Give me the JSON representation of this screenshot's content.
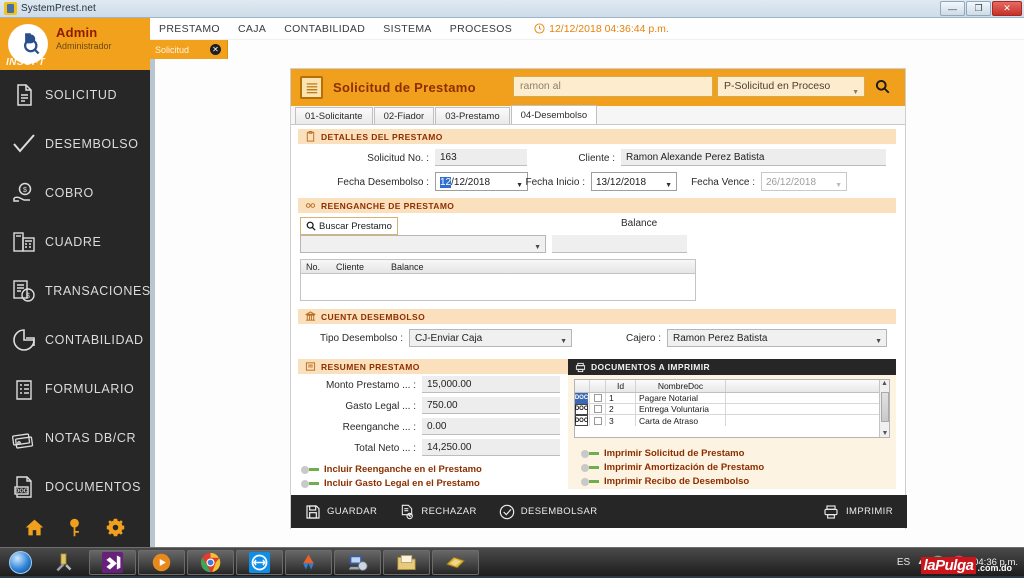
{
  "window": {
    "title": "SystemPrest.net",
    "controls": {
      "minimize": "—",
      "maximize": "❐",
      "close": "✕"
    }
  },
  "sidebar": {
    "user": {
      "name": "Admin",
      "role": "Administrador",
      "brand": "INSOFT"
    },
    "items": [
      {
        "label": "SOLICITUD",
        "icon": "document-icon"
      },
      {
        "label": "DESEMBOLSO",
        "icon": "checkmark-icon"
      },
      {
        "label": "COBRO",
        "icon": "hand-money-icon"
      },
      {
        "label": "CUADRE",
        "icon": "calculator-icon"
      },
      {
        "label": "TRANSACIONES",
        "icon": "transactions-icon"
      },
      {
        "label": "CONTABILIDAD",
        "icon": "pie-chart-icon"
      },
      {
        "label": "FORMULARIO",
        "icon": "clipboard-list-icon"
      },
      {
        "label": "NOTAS DB/CR",
        "icon": "cards-icon"
      },
      {
        "label": "DOCUMENTOS",
        "icon": "doc-file-icon"
      }
    ],
    "footer": [
      {
        "icon": "home-icon"
      },
      {
        "icon": "key-icon"
      },
      {
        "icon": "gear-icon"
      }
    ]
  },
  "menubar": {
    "items": [
      "PRESTAMO",
      "CAJA",
      "CONTABILIDAD",
      "SISTEMA",
      "PROCESOS"
    ],
    "clock_icon": "clock-icon",
    "clock": "12/12/2018 04:36:44 p.m."
  },
  "doc_tab": {
    "label": "Solicitud",
    "close": "✕"
  },
  "panel": {
    "icon": "form-icon",
    "title": "Solicitud de Prestamo",
    "search_value": "ramon al",
    "search_placeholder": "ramon al",
    "status_filter": "P-Solicitud en Proceso",
    "search_icon": "search-icon",
    "tabs": [
      {
        "label": "01-Solicitante",
        "active": false
      },
      {
        "label": "02-Fiador",
        "active": false
      },
      {
        "label": "03-Prestamo",
        "active": false
      },
      {
        "label": "04-Desembolso",
        "active": true
      }
    ]
  },
  "detalles": {
    "section_title": "DETALLES DEL PRESTAMO",
    "section_icon": "clipboard-icon",
    "solicitud_label": "Solicitud No. :",
    "solicitud_value": "163",
    "cliente_label": "Cliente :",
    "cliente_value": "Ramon Alexande Perez Batista",
    "fecha_desembolso_label": "Fecha Desembolso :",
    "fecha_desembolso_hl": "12",
    "fecha_desembolso_rest": "/12/2018",
    "fecha_inicio_label": "Fecha Inicio :",
    "fecha_inicio_value": "13/12/2018",
    "fecha_vence_label": "Fecha Vence :",
    "fecha_vence_value": "26/12/2018"
  },
  "reenganche": {
    "section_title": "REENGANCHE DE PRESTAMO",
    "section_icon": "link-icon",
    "buscar_button": "Buscar Prestamo",
    "buscar_icon": "search-icon",
    "combo_value": "",
    "balance_label": "Balance",
    "balance_value": "",
    "grid_columns": [
      "No.",
      "Cliente",
      "Balance"
    ],
    "grid_rows": []
  },
  "cuenta": {
    "section_title": "CUENTA DESEMBOLSO",
    "section_icon": "bank-icon",
    "tipo_label": "Tipo Desembolso :",
    "tipo_value": "CJ-Enviar Caja",
    "cajero_label": "Cajero :",
    "cajero_value": "Ramon Perez Batista"
  },
  "resumen": {
    "section_title": "RESUMEN PRESTAMO",
    "section_icon": "money-list-icon",
    "rows": [
      {
        "label": "Monto Prestamo ... :",
        "value": "15,000.00"
      },
      {
        "label": "Gasto Legal ... :",
        "value": "750.00"
      },
      {
        "label": "Reenganche ... :",
        "value": "0.00"
      },
      {
        "label": "Total Neto ... :",
        "value": "14,250.00"
      }
    ],
    "toggles": [
      {
        "label": "Incluir Reenganche en el Prestamo",
        "on": false
      },
      {
        "label": "Incluir Gasto Legal en el Prestamo",
        "on": false
      }
    ]
  },
  "documentos": {
    "section_title": "DOCUMENTOS A IMPRIMIR",
    "section_icon": "printer-icon",
    "columns": [
      "",
      "",
      "Id",
      "NombreDoc"
    ],
    "rows": [
      {
        "id": "1",
        "nombre": "Pagare Notarial",
        "checked": false,
        "icon": "doc-icon"
      },
      {
        "id": "2",
        "nombre": "Entrega Voluntaria",
        "checked": false,
        "icon": "doc-icon"
      },
      {
        "id": "3",
        "nombre": "Carta de Atraso",
        "checked": false,
        "icon": "doc-icon"
      }
    ],
    "toggles": [
      {
        "label": "Imprimir Solicitud de Prestamo",
        "on": false
      },
      {
        "label": "Imprimir Amortización de Prestamo",
        "on": false
      },
      {
        "label": "Imprimir Recibo de Desembolso",
        "on": false
      }
    ],
    "scroll_up": "▲",
    "scroll_down": "▼"
  },
  "actions": {
    "guardar": {
      "label": "GUARDAR",
      "icon": "save-icon"
    },
    "rechazar": {
      "label": "RECHAZAR",
      "icon": "reject-doc-icon"
    },
    "desembolsar": {
      "label": "DESEMBOLSAR",
      "icon": "check-circle-icon"
    },
    "imprimir": {
      "label": "IMPRIMIR",
      "icon": "printer-icon"
    }
  },
  "taskbar": {
    "start_icon": "windows-start-orb",
    "buttons": [
      {
        "icon": "tools-icon"
      },
      {
        "icon": "visual-studio-icon"
      },
      {
        "icon": "media-player-icon"
      },
      {
        "icon": "chrome-icon"
      },
      {
        "icon": "teamviewer-icon"
      },
      {
        "icon": "drive-icon"
      },
      {
        "icon": "computer-icon"
      },
      {
        "icon": "folder-icon"
      },
      {
        "icon": "money-app-icon"
      }
    ],
    "tray": {
      "language": "ES",
      "chevron": "▲",
      "icons": [
        "messenger-icon",
        "mail-icon"
      ],
      "time": "04:36 p.m."
    },
    "watermark": {
      "main": "laPulga",
      "suffix": ".com.do"
    }
  },
  "colors": {
    "brand_orange": "#f0a01d",
    "sidebar_dark": "#272727",
    "section_tan": "#fbe0bd",
    "section_title": "#8f2f00",
    "accent_red": "#c9151b"
  }
}
